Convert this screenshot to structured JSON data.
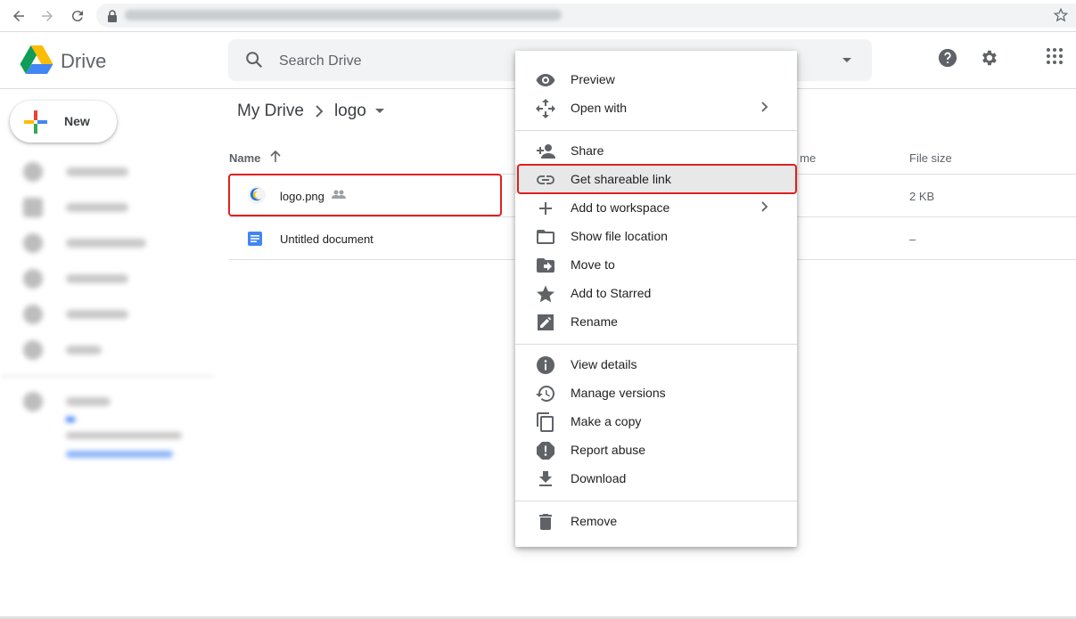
{
  "app": {
    "name": "Drive"
  },
  "search": {
    "placeholder": "Search Drive"
  },
  "sidebar": {
    "new_label": "New"
  },
  "breadcrumb": {
    "root": "My Drive",
    "current": "logo"
  },
  "table": {
    "headers": {
      "name": "Name",
      "modified": "y me",
      "size": "File size"
    },
    "rows": [
      {
        "name": "logo.png",
        "size": "2 KB"
      },
      {
        "name": "Untitled document",
        "size": "–"
      }
    ]
  },
  "menu": {
    "items": [
      {
        "label": "Preview"
      },
      {
        "label": "Open with"
      },
      {
        "label": "Share"
      },
      {
        "label": "Get shareable link"
      },
      {
        "label": "Add to workspace"
      },
      {
        "label": "Show file location"
      },
      {
        "label": "Move to"
      },
      {
        "label": "Add to Starred"
      },
      {
        "label": "Rename"
      },
      {
        "label": "View details"
      },
      {
        "label": "Manage versions"
      },
      {
        "label": "Make a copy"
      },
      {
        "label": "Report abuse"
      },
      {
        "label": "Download"
      },
      {
        "label": "Remove"
      }
    ]
  },
  "colors": {
    "accent": "#1a73e8",
    "highlight": "#e02020",
    "doc_blue": "#4285f4"
  }
}
